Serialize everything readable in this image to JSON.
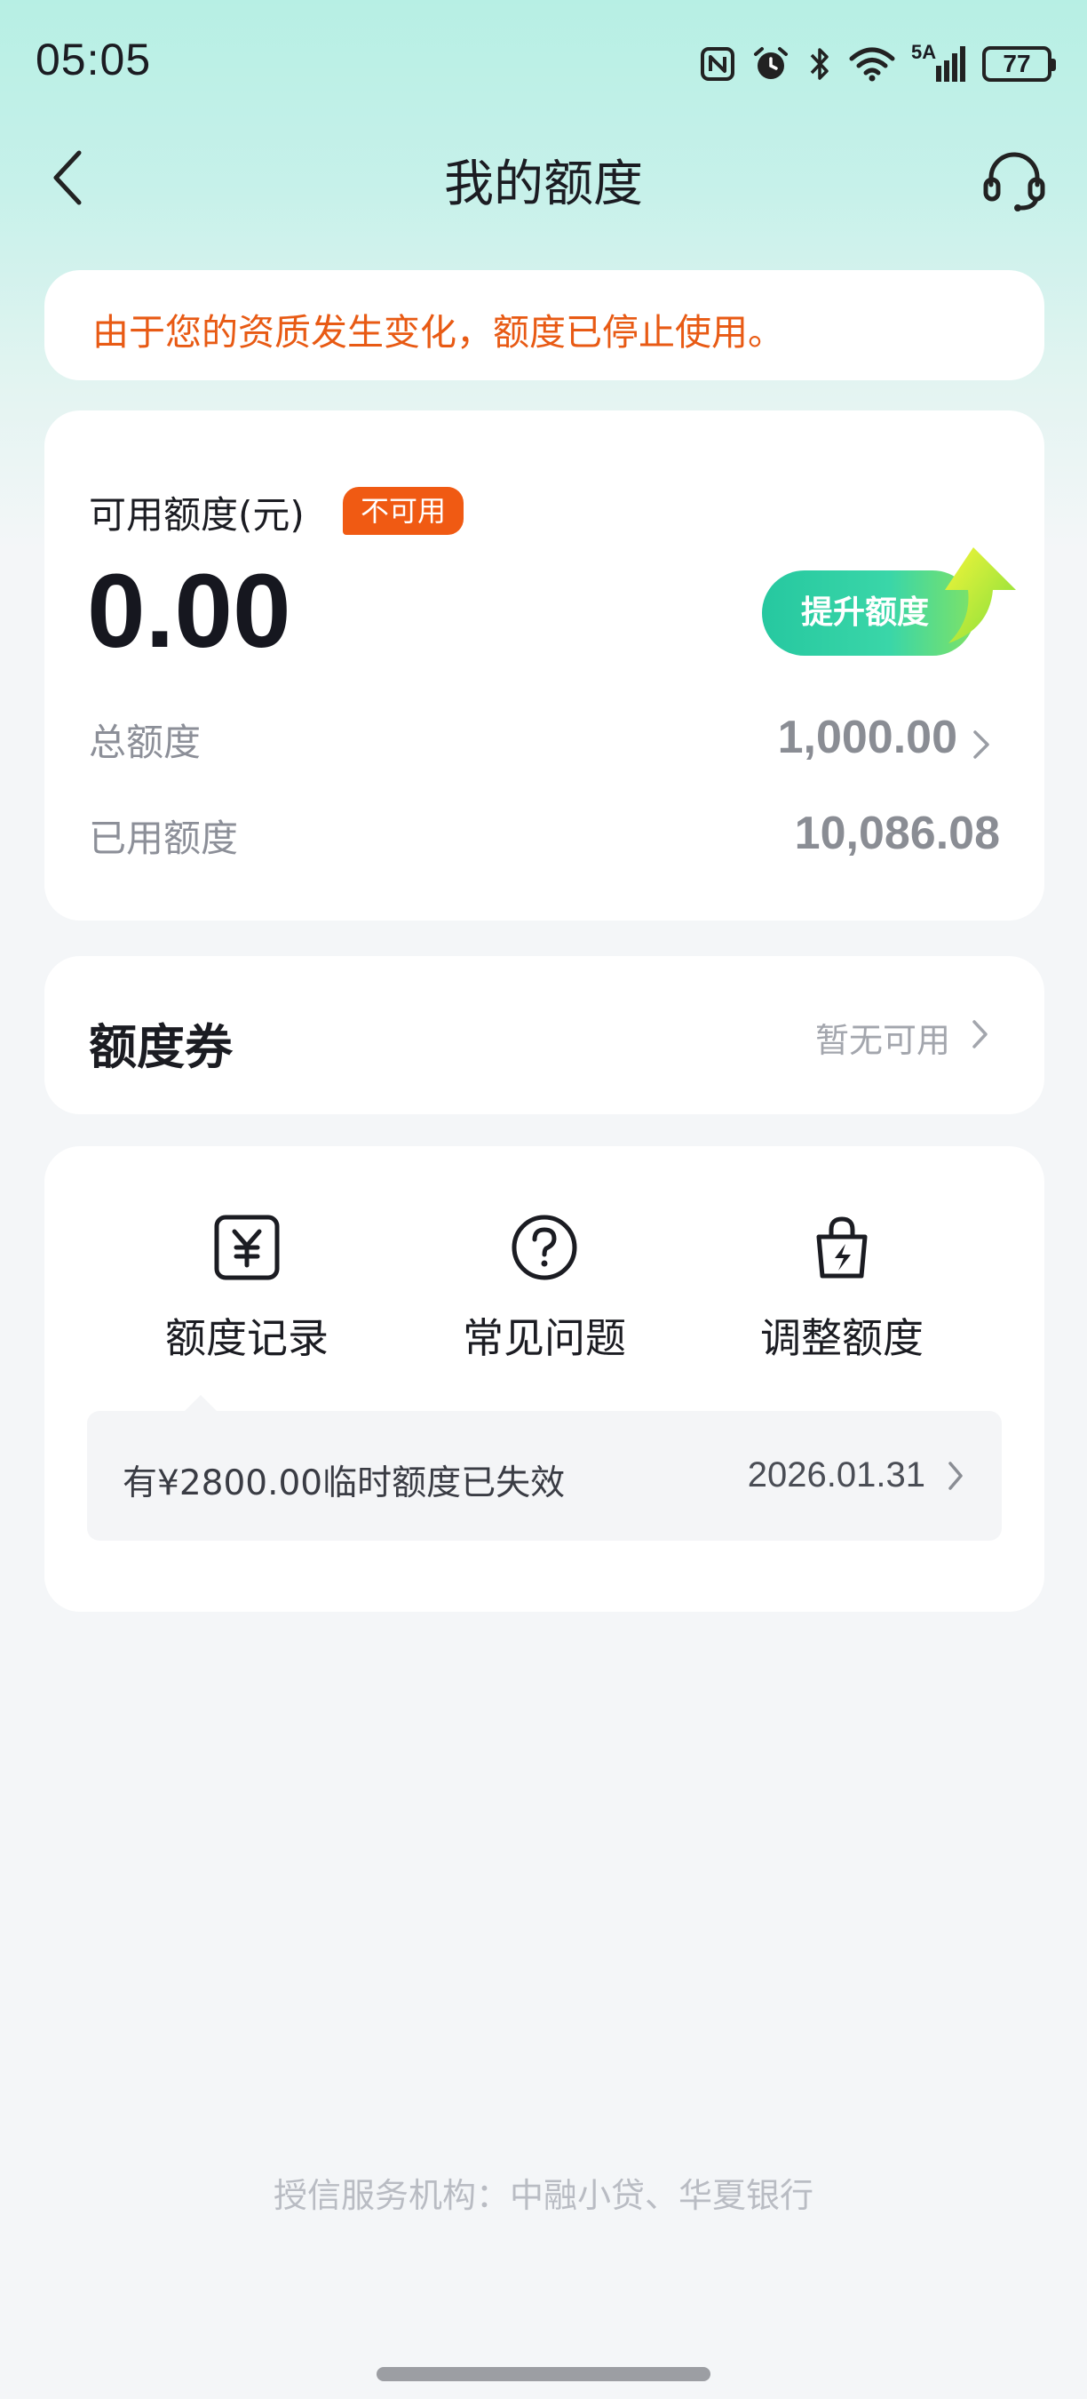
{
  "status_bar": {
    "time": "05:05",
    "network": "5A",
    "battery": "77",
    "icons": [
      "nfc-icon",
      "alarm-icon",
      "bluetooth-icon",
      "wifi-icon",
      "signal-icon",
      "battery-icon"
    ]
  },
  "nav": {
    "title": "我的额度",
    "back_icon": "chevron-left-icon",
    "support_icon": "headset-icon"
  },
  "notice": {
    "text": "由于您的资质发生变化，额度已停止使用。",
    "color": "#e85a14"
  },
  "quota": {
    "available_label": "可用额度(元)",
    "status_badge": "不可用",
    "available_amount": "0.00",
    "raise_button": "提升额度",
    "total_label": "总额度",
    "total_value": "1,000.00",
    "used_label": "已用额度",
    "used_value": "10,086.08"
  },
  "coupon": {
    "title": "额度券",
    "status": "暂无可用"
  },
  "actions": {
    "items": [
      {
        "label": "额度记录",
        "icon": "yuan-record-icon"
      },
      {
        "label": "常见问题",
        "icon": "question-circle-icon"
      },
      {
        "label": "调整额度",
        "icon": "bag-lightning-icon"
      }
    ],
    "tip_text": "有¥2800.00临时额度已失效",
    "tip_date": "2026.01.31"
  },
  "footer": {
    "text": "授信服务机构：中融小贷、华夏银行"
  },
  "colors": {
    "accent": "#26c8a0",
    "badge": "#f05a13",
    "warning_text": "#e85a14"
  }
}
